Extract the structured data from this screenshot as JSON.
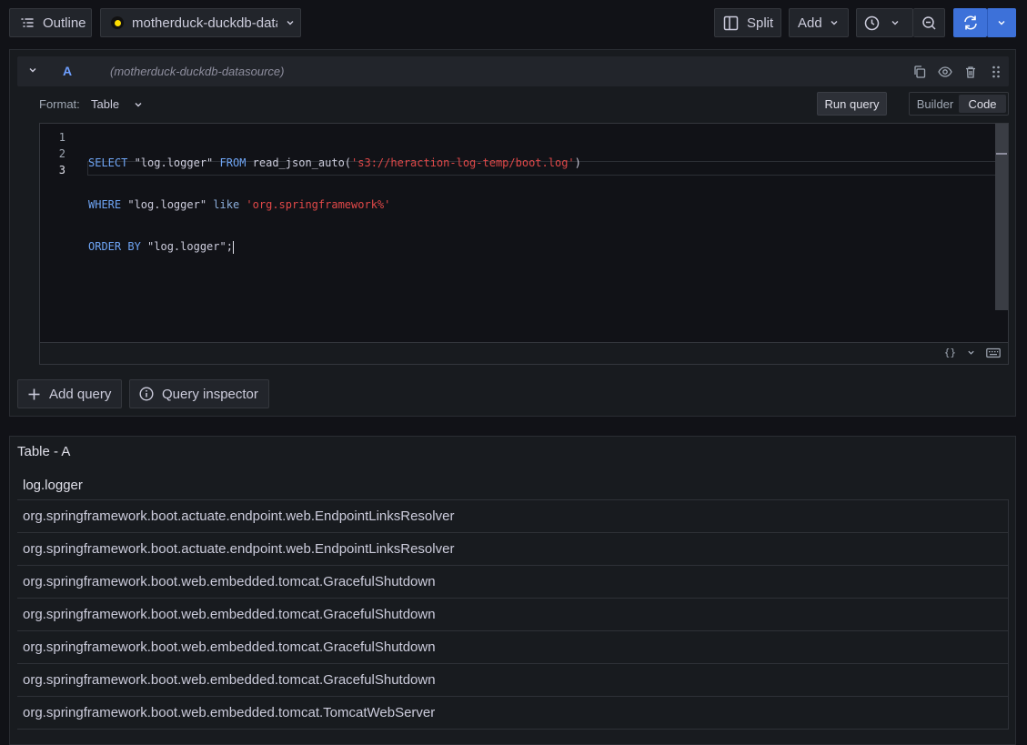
{
  "toolbar": {
    "outline_label": "Outline",
    "datasource_name": "motherduck-duckdb-datasource",
    "split_label": "Split",
    "add_label": "Add"
  },
  "query": {
    "ref_id": "A",
    "datasource_ref": "(motherduck-duckdb-datasource)",
    "format_label": "Format:",
    "format_value": "Table",
    "run_label": "Run query",
    "mode_builder": "Builder",
    "mode_code": "Code",
    "line_numbers": [
      "1",
      "2",
      "3"
    ],
    "sql": {
      "l1_kw1": "SELECT",
      "l1_t1": " \"log.logger\" ",
      "l1_kw2": "FROM",
      "l1_t2": " read_json_auto(",
      "l1_str": "'s3://heraction-log-temp/boot.log'",
      "l1_t3": ")",
      "l2_kw1": "WHERE",
      "l2_t1": " \"log.logger\" ",
      "l2_kw2": "like",
      "l2_t2": " ",
      "l2_str": "'org.springframework%'",
      "l3_kw1": "ORDER BY",
      "l3_t1": " \"log.logger\";"
    },
    "format_icon_label": "{}"
  },
  "actions": {
    "add_query_label": "Add query",
    "query_inspector_label": "Query inspector"
  },
  "results": {
    "title": "Table - A",
    "column": "log.logger",
    "rows": [
      "org.springframework.boot.actuate.endpoint.web.EndpointLinksResolver",
      "org.springframework.boot.actuate.endpoint.web.EndpointLinksResolver",
      "org.springframework.boot.web.embedded.tomcat.GracefulShutdown",
      "org.springframework.boot.web.embedded.tomcat.GracefulShutdown",
      "org.springframework.boot.web.embedded.tomcat.GracefulShutdown",
      "org.springframework.boot.web.embedded.tomcat.GracefulShutdown",
      "org.springframework.boot.web.embedded.tomcat.TomcatWebServer"
    ]
  },
  "colors": {
    "primary": "#3d71d9",
    "keyword": "#6ea4f4",
    "string": "#e04848",
    "ref_id": "#6e9fff"
  }
}
